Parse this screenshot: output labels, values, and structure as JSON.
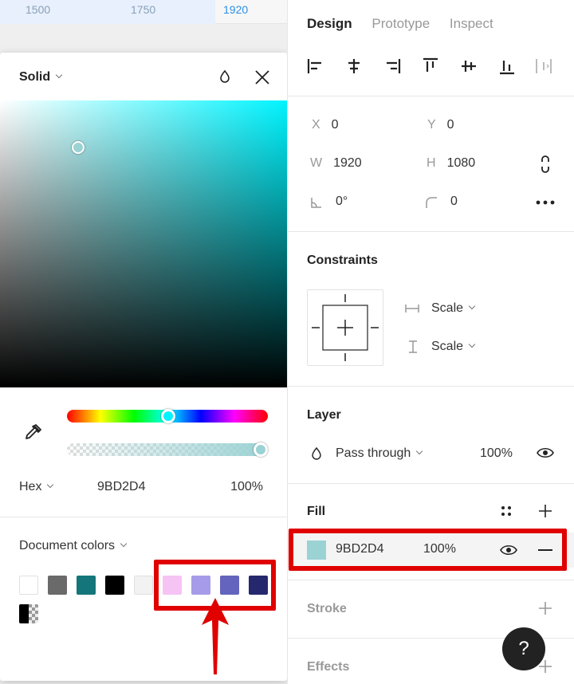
{
  "ruler": {
    "ticks": [
      "1500",
      "1750",
      "1920"
    ]
  },
  "picker": {
    "mode": "Solid",
    "hex_label": "Hex",
    "hex_value": "9BD2D4",
    "opacity": "100%",
    "doc_colors_label": "Document colors",
    "hue_position": 0.5,
    "alpha_position": 1.0,
    "swatches": [
      "#ffffff",
      "#6a6a6a",
      "#14767a",
      "#000000",
      "#f2f2f2",
      "#f6c3f5",
      "#a69be8",
      "#6464be",
      "#26286e"
    ]
  },
  "panel": {
    "tabs": [
      "Design",
      "Prototype",
      "Inspect"
    ],
    "x_label": "X",
    "x_value": "0",
    "y_label": "Y",
    "y_value": "0",
    "w_label": "W",
    "w_value": "1920",
    "h_label": "H",
    "h_value": "1080",
    "rotation_value": "0°",
    "radius_value": "0",
    "constraints_title": "Constraints",
    "constraint_h": "Scale",
    "constraint_v": "Scale",
    "layer_title": "Layer",
    "blend_mode": "Pass through",
    "layer_opacity": "100%",
    "fill_title": "Fill",
    "fill_hex": "9BD2D4",
    "fill_opacity": "100%",
    "stroke_title": "Stroke",
    "effects_title": "Effects",
    "help_label": "?"
  },
  "colors": {
    "fill": "#9bd2d4",
    "highlight": "#e00000",
    "accent": "#2d8fe6"
  }
}
